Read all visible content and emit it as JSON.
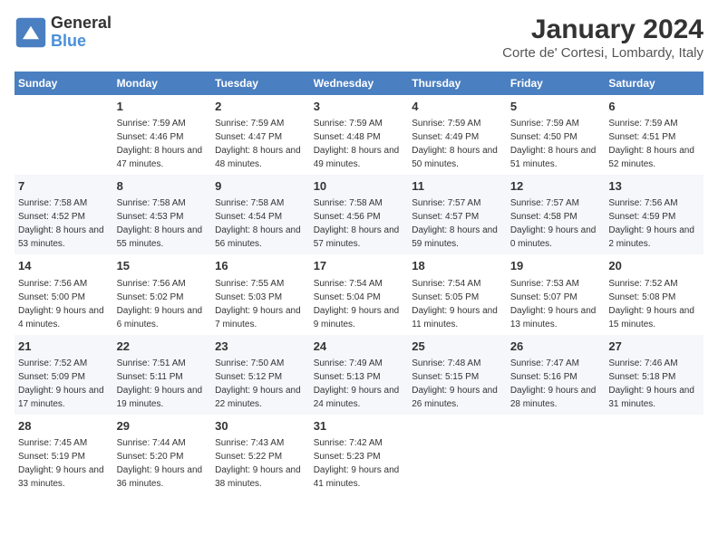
{
  "header": {
    "logo_line1": "General",
    "logo_line2": "Blue",
    "title": "January 2024",
    "subtitle": "Corte de' Cortesi, Lombardy, Italy"
  },
  "days_of_week": [
    "Sunday",
    "Monday",
    "Tuesday",
    "Wednesday",
    "Thursday",
    "Friday",
    "Saturday"
  ],
  "weeks": [
    [
      {
        "day": "",
        "sunrise": "",
        "sunset": "",
        "daylight": ""
      },
      {
        "day": "1",
        "sunrise": "Sunrise: 7:59 AM",
        "sunset": "Sunset: 4:46 PM",
        "daylight": "Daylight: 8 hours and 47 minutes."
      },
      {
        "day": "2",
        "sunrise": "Sunrise: 7:59 AM",
        "sunset": "Sunset: 4:47 PM",
        "daylight": "Daylight: 8 hours and 48 minutes."
      },
      {
        "day": "3",
        "sunrise": "Sunrise: 7:59 AM",
        "sunset": "Sunset: 4:48 PM",
        "daylight": "Daylight: 8 hours and 49 minutes."
      },
      {
        "day": "4",
        "sunrise": "Sunrise: 7:59 AM",
        "sunset": "Sunset: 4:49 PM",
        "daylight": "Daylight: 8 hours and 50 minutes."
      },
      {
        "day": "5",
        "sunrise": "Sunrise: 7:59 AM",
        "sunset": "Sunset: 4:50 PM",
        "daylight": "Daylight: 8 hours and 51 minutes."
      },
      {
        "day": "6",
        "sunrise": "Sunrise: 7:59 AM",
        "sunset": "Sunset: 4:51 PM",
        "daylight": "Daylight: 8 hours and 52 minutes."
      }
    ],
    [
      {
        "day": "7",
        "sunrise": "Sunrise: 7:58 AM",
        "sunset": "Sunset: 4:52 PM",
        "daylight": "Daylight: 8 hours and 53 minutes."
      },
      {
        "day": "8",
        "sunrise": "Sunrise: 7:58 AM",
        "sunset": "Sunset: 4:53 PM",
        "daylight": "Daylight: 8 hours and 55 minutes."
      },
      {
        "day": "9",
        "sunrise": "Sunrise: 7:58 AM",
        "sunset": "Sunset: 4:54 PM",
        "daylight": "Daylight: 8 hours and 56 minutes."
      },
      {
        "day": "10",
        "sunrise": "Sunrise: 7:58 AM",
        "sunset": "Sunset: 4:56 PM",
        "daylight": "Daylight: 8 hours and 57 minutes."
      },
      {
        "day": "11",
        "sunrise": "Sunrise: 7:57 AM",
        "sunset": "Sunset: 4:57 PM",
        "daylight": "Daylight: 8 hours and 59 minutes."
      },
      {
        "day": "12",
        "sunrise": "Sunrise: 7:57 AM",
        "sunset": "Sunset: 4:58 PM",
        "daylight": "Daylight: 9 hours and 0 minutes."
      },
      {
        "day": "13",
        "sunrise": "Sunrise: 7:56 AM",
        "sunset": "Sunset: 4:59 PM",
        "daylight": "Daylight: 9 hours and 2 minutes."
      }
    ],
    [
      {
        "day": "14",
        "sunrise": "Sunrise: 7:56 AM",
        "sunset": "Sunset: 5:00 PM",
        "daylight": "Daylight: 9 hours and 4 minutes."
      },
      {
        "day": "15",
        "sunrise": "Sunrise: 7:56 AM",
        "sunset": "Sunset: 5:02 PM",
        "daylight": "Daylight: 9 hours and 6 minutes."
      },
      {
        "day": "16",
        "sunrise": "Sunrise: 7:55 AM",
        "sunset": "Sunset: 5:03 PM",
        "daylight": "Daylight: 9 hours and 7 minutes."
      },
      {
        "day": "17",
        "sunrise": "Sunrise: 7:54 AM",
        "sunset": "Sunset: 5:04 PM",
        "daylight": "Daylight: 9 hours and 9 minutes."
      },
      {
        "day": "18",
        "sunrise": "Sunrise: 7:54 AM",
        "sunset": "Sunset: 5:05 PM",
        "daylight": "Daylight: 9 hours and 11 minutes."
      },
      {
        "day": "19",
        "sunrise": "Sunrise: 7:53 AM",
        "sunset": "Sunset: 5:07 PM",
        "daylight": "Daylight: 9 hours and 13 minutes."
      },
      {
        "day": "20",
        "sunrise": "Sunrise: 7:52 AM",
        "sunset": "Sunset: 5:08 PM",
        "daylight": "Daylight: 9 hours and 15 minutes."
      }
    ],
    [
      {
        "day": "21",
        "sunrise": "Sunrise: 7:52 AM",
        "sunset": "Sunset: 5:09 PM",
        "daylight": "Daylight: 9 hours and 17 minutes."
      },
      {
        "day": "22",
        "sunrise": "Sunrise: 7:51 AM",
        "sunset": "Sunset: 5:11 PM",
        "daylight": "Daylight: 9 hours and 19 minutes."
      },
      {
        "day": "23",
        "sunrise": "Sunrise: 7:50 AM",
        "sunset": "Sunset: 5:12 PM",
        "daylight": "Daylight: 9 hours and 22 minutes."
      },
      {
        "day": "24",
        "sunrise": "Sunrise: 7:49 AM",
        "sunset": "Sunset: 5:13 PM",
        "daylight": "Daylight: 9 hours and 24 minutes."
      },
      {
        "day": "25",
        "sunrise": "Sunrise: 7:48 AM",
        "sunset": "Sunset: 5:15 PM",
        "daylight": "Daylight: 9 hours and 26 minutes."
      },
      {
        "day": "26",
        "sunrise": "Sunrise: 7:47 AM",
        "sunset": "Sunset: 5:16 PM",
        "daylight": "Daylight: 9 hours and 28 minutes."
      },
      {
        "day": "27",
        "sunrise": "Sunrise: 7:46 AM",
        "sunset": "Sunset: 5:18 PM",
        "daylight": "Daylight: 9 hours and 31 minutes."
      }
    ],
    [
      {
        "day": "28",
        "sunrise": "Sunrise: 7:45 AM",
        "sunset": "Sunset: 5:19 PM",
        "daylight": "Daylight: 9 hours and 33 minutes."
      },
      {
        "day": "29",
        "sunrise": "Sunrise: 7:44 AM",
        "sunset": "Sunset: 5:20 PM",
        "daylight": "Daylight: 9 hours and 36 minutes."
      },
      {
        "day": "30",
        "sunrise": "Sunrise: 7:43 AM",
        "sunset": "Sunset: 5:22 PM",
        "daylight": "Daylight: 9 hours and 38 minutes."
      },
      {
        "day": "31",
        "sunrise": "Sunrise: 7:42 AM",
        "sunset": "Sunset: 5:23 PM",
        "daylight": "Daylight: 9 hours and 41 minutes."
      },
      {
        "day": "",
        "sunrise": "",
        "sunset": "",
        "daylight": ""
      },
      {
        "day": "",
        "sunrise": "",
        "sunset": "",
        "daylight": ""
      },
      {
        "day": "",
        "sunrise": "",
        "sunset": "",
        "daylight": ""
      }
    ]
  ]
}
